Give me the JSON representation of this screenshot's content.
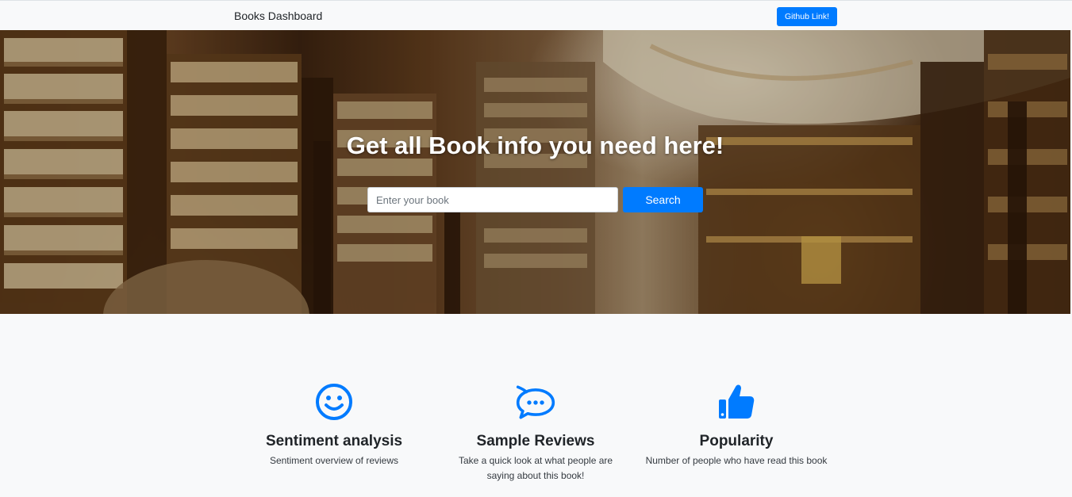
{
  "navbar": {
    "brand": "Books Dashboard",
    "github_button": "Github Link!"
  },
  "hero": {
    "title": "Get all Book info you need here!",
    "search_placeholder": "Enter your book",
    "search_button": "Search"
  },
  "features": [
    {
      "icon": "smiley-face-icon",
      "title": "Sentiment analysis",
      "description": "Sentiment overview of reviews"
    },
    {
      "icon": "chat-bubble-icon",
      "title": "Sample Reviews",
      "description": "Take a quick look at what people are saying about this book!"
    },
    {
      "icon": "thumbs-up-icon",
      "title": "Popularity",
      "description": "Number of people who have read this book"
    }
  ],
  "colors": {
    "primary": "#007bff",
    "background": "#f8f9fa",
    "text": "#212529"
  }
}
